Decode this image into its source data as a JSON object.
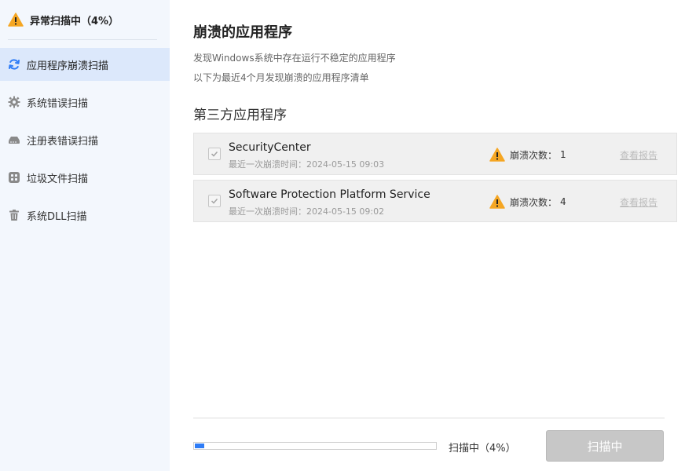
{
  "sidebar": {
    "status_title": "异常扫描中（4%）",
    "items": [
      {
        "label": "应用程序崩溃扫描",
        "icon": "refresh-icon",
        "active": true
      },
      {
        "label": "系统错误扫描",
        "icon": "gear-icon",
        "active": false
      },
      {
        "label": "注册表错误扫描",
        "icon": "registry-icon",
        "active": false
      },
      {
        "label": "垃圾文件扫描",
        "icon": "apps-grid-icon",
        "active": false
      },
      {
        "label": "系统DLL扫描",
        "icon": "trash-icon",
        "active": false
      }
    ]
  },
  "main": {
    "title": "崩溃的应用程序",
    "description_1": "发现Windows系统中存在运行不稳定的应用程序",
    "description_2": "以下为最近4个月发现崩溃的应用程序清单",
    "section_title": "第三方应用程序",
    "apps": [
      {
        "name": "SecurityCenter",
        "last_crash": "最近一次崩溃时间：2024-05-15 09:03",
        "crash_label": "崩溃次数：",
        "crash_count": "1",
        "report_link": "查看报告",
        "checked": true
      },
      {
        "name": "Software Protection Platform Service",
        "last_crash": "最近一次崩溃时间：2024-05-15 09:02",
        "crash_label": "崩溃次数：",
        "crash_count": "4",
        "report_link": "查看报告",
        "checked": true
      }
    ]
  },
  "footer": {
    "progress_fraction": 0.04,
    "progress_label": "扫描中（4%）",
    "scan_button": "扫描中"
  },
  "colors": {
    "accent": "#2e7cf6",
    "warning": "#f5a623",
    "sidebar_bg": "#f3f7fd",
    "active_bg": "#dce8fb",
    "disabled_button": "#c7c7c7"
  }
}
